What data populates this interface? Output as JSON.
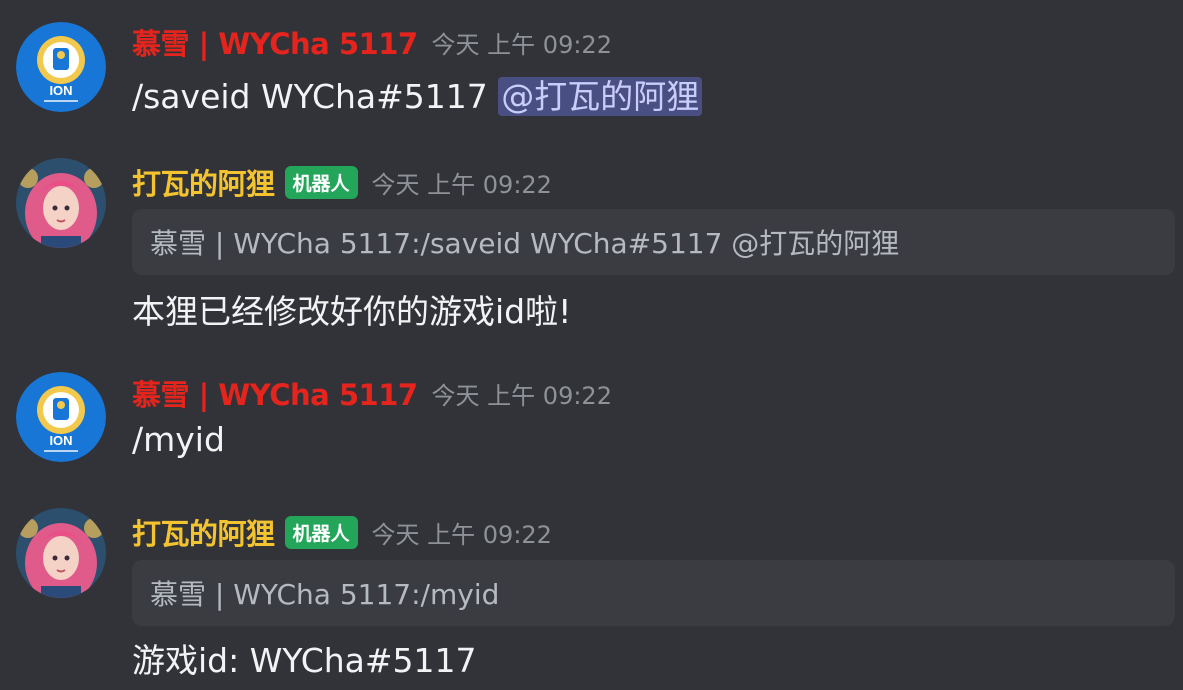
{
  "colors": {
    "background": "#313338",
    "user_name": "#e5251d",
    "bot_name": "#f4c430",
    "bot_tag": "#23a55a",
    "timestamp": "#8e9297",
    "mention_bg": "#4a4f83",
    "quote_bg": "#3a3c42"
  },
  "messages": [
    {
      "author": "慕雪 | WYCha 5117",
      "avatar": "ion-laser-club-logo",
      "timestamp": "今天 上午 09:22",
      "content": "/saveid WYCha#5117 ",
      "mention": "@打瓦的阿狸"
    },
    {
      "author": "打瓦的阿狸",
      "avatar": "pink-haired-girl-avatar",
      "bot_tag": "机器人",
      "timestamp": "今天 上午 09:22",
      "quote": "慕雪 | WYCha 5117:/saveid WYCha#5117 @打瓦的阿狸",
      "content": "本狸已经修改好你的游戏id啦!"
    },
    {
      "author": "慕雪 | WYCha 5117",
      "avatar": "ion-laser-club-logo",
      "timestamp": "今天 上午 09:22",
      "content": "/myid"
    },
    {
      "author": "打瓦的阿狸",
      "avatar": "pink-haired-girl-avatar",
      "bot_tag": "机器人",
      "timestamp": "今天 上午 09:22",
      "quote": "慕雪 | WYCha 5117:/myid",
      "content": "游戏id: WYCha#5117"
    }
  ]
}
